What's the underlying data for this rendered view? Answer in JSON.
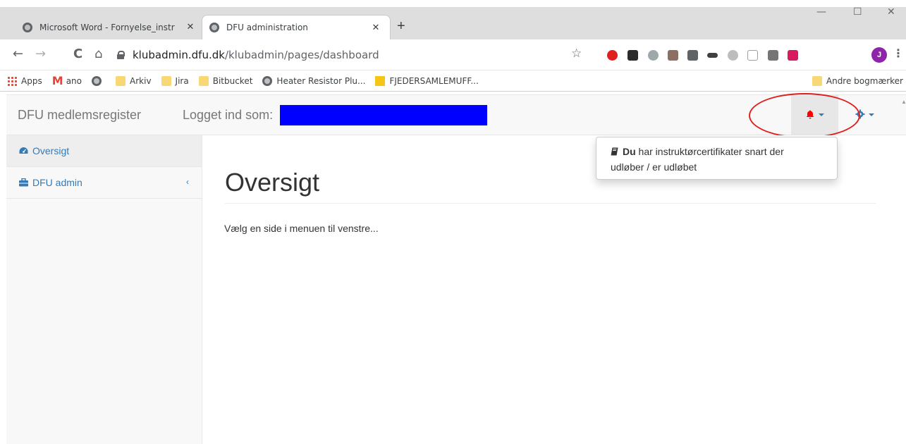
{
  "browser": {
    "tabs": [
      {
        "title": "Microsoft Word - Fornyelse_instr",
        "close": "✕"
      },
      {
        "title": "DFU administration",
        "close": "✕"
      }
    ],
    "new_tab": "+",
    "window_controls": {
      "minimize": "—",
      "maximize": "☐",
      "close": "✕"
    },
    "nav": {
      "back": "←",
      "forward": "→",
      "reload": "C",
      "home": "⌂"
    },
    "url_host": "klubadmin.dfu.dk",
    "url_path": "/klubadmin/pages/dashboard",
    "star": "☆",
    "profile_initial": "J",
    "menu": "⋮"
  },
  "bookmarks": {
    "items": [
      {
        "label": "Apps",
        "icon": "apps-icon"
      },
      {
        "label": "ano",
        "icon": "gmail-icon"
      },
      {
        "label": "",
        "icon": "globe-icon"
      },
      {
        "label": "Arkiv",
        "icon": "folder-icon"
      },
      {
        "label": "Jira",
        "icon": "folder-icon"
      },
      {
        "label": "Bitbucket",
        "icon": "folder-icon"
      },
      {
        "label": "Heater Resistor Plu...",
        "icon": "globe-icon"
      },
      {
        "label": "FJEDERSAMLEMUFF...",
        "icon": "site-icon"
      }
    ],
    "other": "Andre bogmærker"
  },
  "header": {
    "brand": "DFU medlemsregister",
    "logged_in_label": "Logget ind som:"
  },
  "sidebar": {
    "items": [
      {
        "label": "Oversigt",
        "icon": "dashboard-icon"
      },
      {
        "label": "DFU admin",
        "icon": "briefcase-icon",
        "chevron": "‹"
      }
    ]
  },
  "main": {
    "title": "Oversigt",
    "text": "Vælg en side i menuen til venstre..."
  },
  "alerts": {
    "bold": "Du",
    "line1": " har instruktørcertifikater snart der",
    "line2": "udløber / er udløbet"
  },
  "colors": {
    "link": "#337ab7",
    "bell": "#ff0000",
    "redaction": "#0000ff",
    "annotation": "#e0201f"
  }
}
